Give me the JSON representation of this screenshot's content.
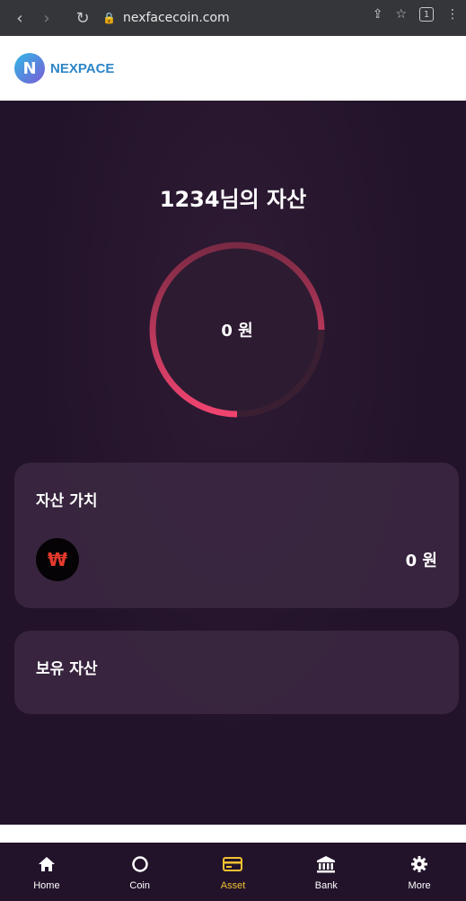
{
  "browser": {
    "url": "nexfacecoin.com",
    "tab_count": "1"
  },
  "brand": {
    "logo_letter": "N",
    "name": "NEXPACE"
  },
  "asset": {
    "title": "1234님의 자산",
    "total": "0 원",
    "ring_progress_color": "#e8416b"
  },
  "value_card": {
    "title": "자산 가치",
    "currency_symbol": "₩",
    "amount": "0 원"
  },
  "holdings_card": {
    "title": "보유 자산"
  },
  "bottom_nav": {
    "items": [
      {
        "label": "Home",
        "icon": "home-icon"
      },
      {
        "label": "Coin",
        "icon": "coin-icon"
      },
      {
        "label": "Asset",
        "icon": "wallet-icon",
        "active": true
      },
      {
        "label": "Bank",
        "icon": "bank-icon"
      },
      {
        "label": "More",
        "icon": "gear-icon"
      }
    ],
    "active_color": "#f2c230"
  }
}
